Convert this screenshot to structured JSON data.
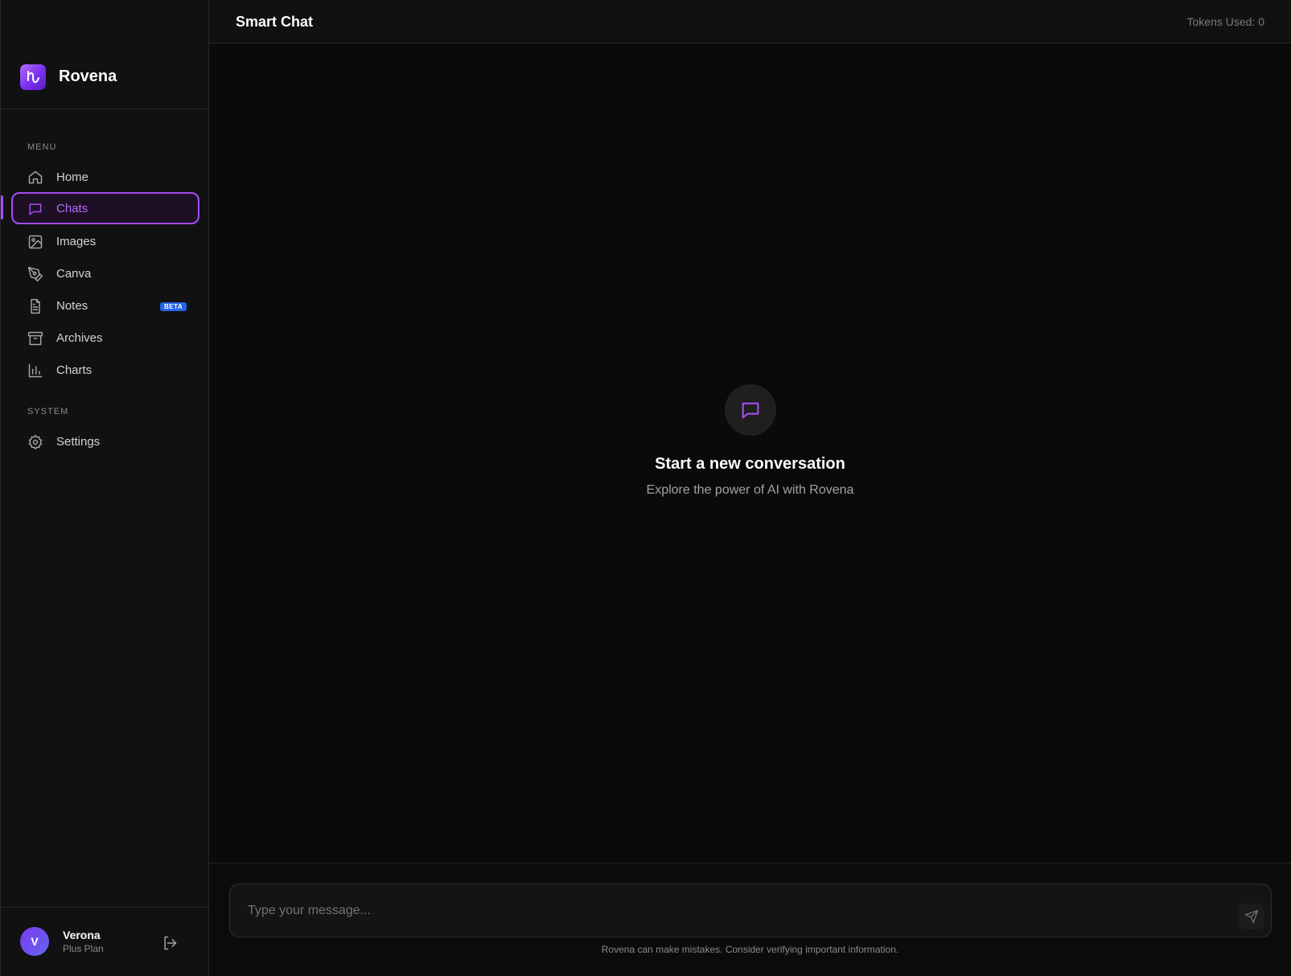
{
  "brand": {
    "name": "Rovena"
  },
  "sidebar": {
    "menu_label": "MENU",
    "system_label": "SYSTEM",
    "items": [
      {
        "label": "Home",
        "icon": "home-icon"
      },
      {
        "label": "Chats",
        "icon": "message-square-icon",
        "active": true
      },
      {
        "label": "Images",
        "icon": "image-icon"
      },
      {
        "label": "Canva",
        "icon": "pen-tool-icon"
      },
      {
        "label": "Notes",
        "icon": "file-text-icon",
        "badge": "BETA"
      },
      {
        "label": "Archives",
        "icon": "archive-icon"
      },
      {
        "label": "Charts",
        "icon": "bar-chart-icon"
      }
    ],
    "system_items": [
      {
        "label": "Settings",
        "icon": "gear-icon"
      }
    ]
  },
  "user": {
    "initial": "V",
    "name": "Verona",
    "plan": "Plus Plan"
  },
  "header": {
    "title": "Smart Chat",
    "tokens": "Tokens Used: 0"
  },
  "empty_state": {
    "title": "Start a new conversation",
    "subtitle": "Explore the power of AI with Rovena"
  },
  "composer": {
    "placeholder": "Type your message...",
    "value": "",
    "disclaimer": "Rovena can make mistakes. Consider verifying important information."
  },
  "colors": {
    "accent": "#a64cf5",
    "background": "#0a0a0a",
    "sidebar": "#111111",
    "badge": "#2563eb"
  }
}
